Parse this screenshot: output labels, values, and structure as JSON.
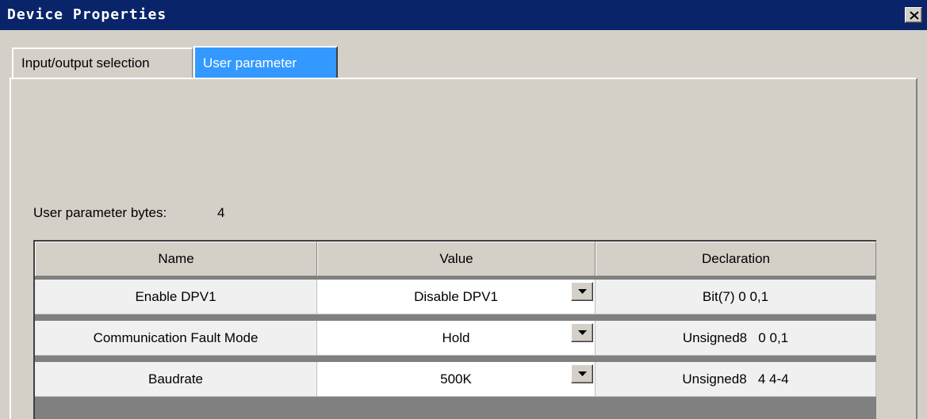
{
  "window": {
    "title": "Device Properties",
    "close_icon": "close-icon"
  },
  "tabs": [
    {
      "label": "Input/output selection",
      "active": false
    },
    {
      "label": "User parameter",
      "active": true
    }
  ],
  "user_parameter": {
    "bytes_label": "User parameter bytes:",
    "bytes_value": "4",
    "columns": [
      "Name",
      "Value",
      "Declaration"
    ],
    "rows": [
      {
        "name": "Enable DPV1",
        "value": "Disable DPV1",
        "declaration": "Bit(7) 0 0,1"
      },
      {
        "name": "Communication Fault Mode",
        "value": "Hold",
        "declaration": "Unsigned8   0 0,1"
      },
      {
        "name": "Baudrate",
        "value": "500K",
        "declaration": "Unsigned8   4 4-4"
      }
    ]
  },
  "colors": {
    "titlebar": "#0a246a",
    "active_tab": "#3399ff",
    "face": "#d4d0c8"
  }
}
